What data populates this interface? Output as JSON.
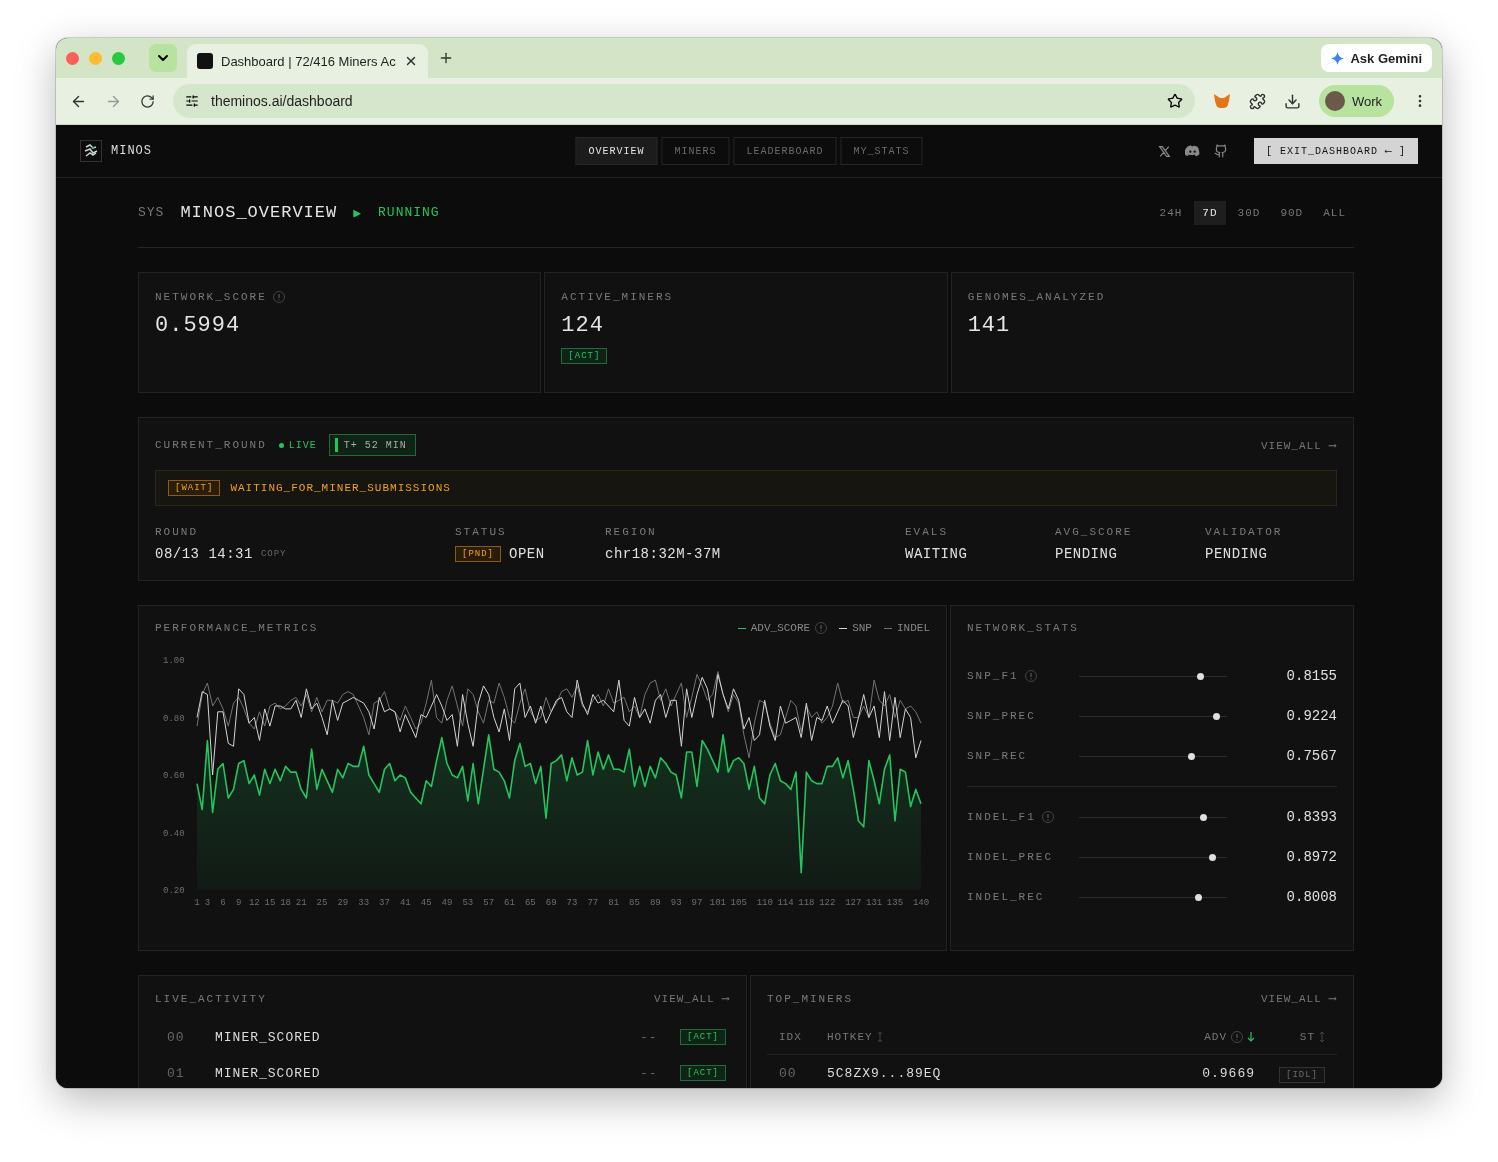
{
  "browser": {
    "tab_title": "Dashboard | 72/416 Miners Ac",
    "url": "theminos.ai/dashboard",
    "gemini_label": "Ask Gemini",
    "profile_label": "Work"
  },
  "header": {
    "brand": "MINOS",
    "nav": [
      {
        "label": "OVERVIEW",
        "selected": true
      },
      {
        "label": "MINERS",
        "selected": false
      },
      {
        "label": "LEADERBOARD",
        "selected": false
      },
      {
        "label": "MY_STATS",
        "selected": false
      }
    ],
    "exit_label": "[ EXIT_DASHBOARD ⟵ ]"
  },
  "title_bar": {
    "prefix": "SYS",
    "title": "MINOS_OVERVIEW",
    "status_icon": "▶",
    "status": "RUNNING",
    "ranges": [
      {
        "label": "24H",
        "selected": false
      },
      {
        "label": "7D",
        "selected": true
      },
      {
        "label": "30D",
        "selected": false
      },
      {
        "label": "90D",
        "selected": false
      },
      {
        "label": "ALL",
        "selected": false
      }
    ]
  },
  "stats": [
    {
      "label": "NETWORK_SCORE",
      "info": true,
      "value": "0.5994"
    },
    {
      "label": "ACTIVE_MINERS",
      "info": false,
      "value": "124",
      "badge": "[ACT]"
    },
    {
      "label": "GENOMES_ANALYZED",
      "info": false,
      "value": "141"
    }
  ],
  "current_round": {
    "title": "CURRENT_ROUND",
    "live": "LIVE",
    "timer": "T+ 52 MIN",
    "view_all": "VIEW_ALL ⟶",
    "alert_badge": "[WAIT]",
    "alert": "WAITING_FOR_MINER_SUBMISSIONS",
    "fields": [
      {
        "label": "ROUND",
        "value": "08/13 14:31",
        "extra": "COPY"
      },
      {
        "label": "STATUS",
        "badge": "[PND]",
        "value": "OPEN"
      },
      {
        "label": "REGION",
        "value": "chr18:32M-37M"
      },
      {
        "label": "EVALS",
        "value": "WAITING"
      },
      {
        "label": "AVG_SCORE",
        "value": "PENDING"
      },
      {
        "label": "VALIDATOR",
        "value": "PENDING"
      }
    ]
  },
  "performance": {
    "title": "PERFORMANCE_METRICS",
    "score_info": true,
    "chart_data": {
      "type": "line",
      "x": [
        1,
        2,
        3,
        4,
        5,
        6,
        7,
        8,
        9,
        10,
        11,
        12,
        13,
        14,
        15,
        16,
        17,
        18,
        19,
        20,
        21,
        22,
        23,
        24,
        25,
        26,
        27,
        28,
        29,
        30,
        31,
        32,
        33,
        34,
        35,
        36,
        37,
        38,
        39,
        40,
        41,
        42,
        43,
        44,
        45,
        46,
        47,
        48,
        49,
        50,
        51,
        52,
        53,
        54,
        55,
        56,
        57,
        58,
        59,
        60,
        61,
        62,
        63,
        64,
        65,
        66,
        67,
        68,
        69,
        70,
        71,
        72,
        73,
        74,
        75,
        76,
        77,
        78,
        79,
        80,
        81,
        82,
        83,
        84,
        85,
        86,
        87,
        88,
        89,
        90,
        91,
        92,
        93,
        94,
        95,
        96,
        97,
        98,
        99,
        100,
        101,
        102,
        103,
        104,
        105,
        106,
        107,
        108,
        109,
        110,
        111,
        112,
        113,
        114,
        115,
        116,
        117,
        118,
        119,
        120,
        121,
        122,
        123,
        124,
        125,
        126,
        127,
        128,
        129,
        130,
        131,
        132,
        133,
        134,
        135,
        136,
        137,
        138,
        139,
        140
      ],
      "ylim": [
        0.2,
        1.0
      ],
      "yticks": [
        {
          "value": 1.0,
          "label": "1.00"
        },
        {
          "value": 0.8,
          "label": "0.80"
        },
        {
          "value": 0.6,
          "label": "0.60"
        },
        {
          "value": 0.4,
          "label": "0.40"
        },
        {
          "value": 0.2,
          "label": "0.20"
        }
      ],
      "xlim": [
        1,
        140
      ],
      "xticks": [
        1,
        3,
        6,
        9,
        12,
        15,
        18,
        21,
        25,
        29,
        33,
        37,
        41,
        45,
        49,
        53,
        57,
        61,
        65,
        69,
        73,
        77,
        81,
        85,
        89,
        93,
        97,
        101,
        105,
        110,
        114,
        118,
        122,
        127,
        131,
        135,
        140
      ],
      "series": [
        {
          "name": "ADV_SCORE",
          "color": "#22c55e",
          "type": "area",
          "values": [
            0.57,
            0.48,
            0.72,
            0.47,
            0.62,
            0.64,
            0.52,
            0.55,
            0.64,
            0.65,
            0.57,
            0.6,
            0.53,
            0.62,
            0.57,
            0.62,
            0.58,
            0.63,
            0.61,
            0.61,
            0.55,
            0.52,
            0.69,
            0.55,
            0.62,
            0.58,
            0.54,
            0.62,
            0.59,
            0.64,
            0.63,
            0.63,
            0.7,
            0.6,
            0.57,
            0.54,
            0.62,
            0.64,
            0.58,
            0.6,
            0.59,
            0.54,
            0.52,
            0.5,
            0.58,
            0.56,
            0.65,
            0.73,
            0.64,
            0.6,
            0.59,
            0.63,
            0.51,
            0.64,
            0.5,
            0.62,
            0.74,
            0.62,
            0.61,
            0.58,
            0.52,
            0.65,
            0.71,
            0.63,
            0.64,
            0.57,
            0.63,
            0.45,
            0.64,
            0.65,
            0.67,
            0.58,
            0.66,
            0.6,
            0.61,
            0.72,
            0.6,
            0.68,
            0.62,
            0.67,
            0.62,
            0.62,
            0.61,
            0.69,
            0.56,
            0.63,
            0.56,
            0.63,
            0.59,
            0.66,
            0.64,
            0.61,
            0.6,
            0.52,
            0.68,
            0.68,
            0.56,
            0.72,
            0.69,
            0.65,
            0.61,
            0.74,
            0.61,
            0.65,
            0.66,
            0.64,
            0.55,
            0.63,
            0.52,
            0.5,
            0.6,
            0.64,
            0.58,
            0.57,
            0.55,
            0.61,
            0.26,
            0.61,
            0.58,
            0.57,
            0.57,
            0.63,
            0.63,
            0.66,
            0.59,
            0.65,
            0.55,
            0.44,
            0.42,
            0.65,
            0.58,
            0.5,
            0.62,
            0.67,
            0.44,
            0.62,
            0.61,
            0.49,
            0.55,
            0.5
          ]
        },
        {
          "name": "SNP",
          "color": "#d4d4d4",
          "values": [
            0.8,
            0.89,
            0.88,
            0.6,
            0.82,
            0.82,
            0.71,
            0.7,
            0.9,
            0.88,
            0.78,
            0.8,
            0.72,
            0.83,
            0.77,
            0.84,
            0.84,
            0.83,
            0.83,
            0.86,
            0.8,
            0.9,
            0.83,
            0.85,
            0.8,
            0.74,
            0.86,
            0.79,
            0.85,
            0.86,
            0.87,
            0.86,
            0.85,
            0.82,
            0.76,
            0.87,
            0.82,
            0.83,
            0.82,
            0.75,
            0.81,
            0.77,
            0.73,
            0.81,
            0.8,
            0.84,
            0.88,
            0.84,
            0.79,
            0.81,
            0.7,
            0.88,
            0.78,
            0.7,
            0.85,
            0.91,
            0.88,
            0.8,
            0.75,
            0.83,
            0.72,
            0.9,
            0.92,
            0.8,
            0.84,
            0.78,
            0.84,
            0.78,
            0.82,
            0.86,
            0.87,
            0.82,
            0.8,
            0.93,
            0.85,
            0.81,
            0.88,
            0.85,
            0.86,
            0.84,
            0.82,
            0.93,
            0.79,
            0.77,
            0.87,
            0.8,
            0.83,
            0.78,
            0.86,
            0.88,
            0.8,
            0.86,
            0.86,
            0.7,
            0.9,
            0.8,
            0.88,
            0.94,
            0.9,
            0.8,
            0.95,
            0.88,
            0.83,
            0.9,
            0.86,
            0.76,
            0.8,
            0.72,
            0.74,
            0.86,
            0.77,
            0.72,
            0.84,
            0.78,
            0.79,
            0.8,
            0.73,
            0.85,
            0.72,
            0.8,
            0.79,
            0.84,
            0.78,
            0.82,
            0.86,
            0.84,
            0.73,
            0.8,
            0.88,
            0.8,
            0.84,
            0.73,
            0.89,
            0.72,
            0.87,
            0.73,
            0.83,
            0.8,
            0.66,
            0.72
          ]
        },
        {
          "name": "INDEL",
          "color": "#737373",
          "values": [
            0.77,
            0.88,
            0.92,
            0.84,
            0.87,
            0.83,
            0.77,
            0.85,
            0.87,
            0.83,
            0.78,
            0.76,
            0.82,
            0.77,
            0.84,
            0.85,
            0.83,
            0.84,
            0.86,
            0.87,
            0.84,
            0.88,
            0.82,
            0.87,
            0.82,
            0.86,
            0.86,
            0.85,
            0.88,
            0.89,
            0.88,
            0.84,
            0.8,
            0.74,
            0.85,
            0.86,
            0.89,
            0.83,
            0.82,
            0.79,
            0.84,
            0.8,
            0.76,
            0.78,
            0.85,
            0.93,
            0.8,
            0.78,
            0.86,
            0.91,
            0.84,
            0.77,
            0.9,
            0.88,
            0.82,
            0.78,
            0.86,
            0.85,
            0.92,
            0.87,
            0.8,
            0.78,
            0.85,
            0.9,
            0.82,
            0.79,
            0.8,
            0.87,
            0.82,
            0.85,
            0.89,
            0.9,
            0.87,
            0.91,
            0.84,
            0.82,
            0.86,
            0.88,
            0.84,
            0.9,
            0.85,
            0.86,
            0.87,
            0.82,
            0.84,
            0.8,
            0.88,
            0.92,
            0.93,
            0.86,
            0.9,
            0.84,
            0.88,
            0.92,
            0.8,
            0.87,
            0.95,
            0.91,
            0.86,
            0.88,
            0.96,
            0.88,
            0.82,
            0.88,
            0.85,
            0.74,
            0.66,
            0.78,
            0.86,
            0.85,
            0.78,
            0.73,
            0.74,
            0.8,
            0.86,
            0.84,
            0.75,
            0.84,
            0.8,
            0.82,
            0.78,
            0.8,
            0.84,
            0.92,
            0.85,
            0.86,
            0.8,
            0.8,
            0.84,
            0.8,
            0.93,
            0.86,
            0.84,
            0.88,
            0.8,
            0.86,
            0.83,
            0.84,
            0.82,
            0.78
          ]
        }
      ]
    }
  },
  "network_stats": {
    "title": "NETWORK_STATS",
    "groups": [
      [
        {
          "label": "SNP_F1",
          "info": true,
          "level": 0.8155,
          "value": "0.8155"
        },
        {
          "label": "SNP_PREC",
          "info": false,
          "level": 0.9224,
          "value": "0.9224"
        },
        {
          "label": "SNP_REC",
          "info": false,
          "level": 0.7567,
          "value": "0.7567"
        }
      ],
      [
        {
          "label": "INDEL_F1",
          "info": true,
          "level": 0.8393,
          "value": "0.8393"
        },
        {
          "label": "INDEL_PREC",
          "info": false,
          "level": 0.8972,
          "value": "0.8972"
        },
        {
          "label": "INDEL_REC",
          "info": false,
          "level": 0.8008,
          "value": "0.8008"
        }
      ]
    ]
  },
  "live_activity": {
    "title": "LIVE_ACTIVITY",
    "view_all": "VIEW_ALL ⟶",
    "rows": [
      {
        "index": "00",
        "event": "MINER_SCORED",
        "detail": "--",
        "badge": "[ACT]",
        "kind": "active"
      },
      {
        "index": "01",
        "event": "MINER_SCORED",
        "detail": "--",
        "badge": "[ACT]",
        "kind": "active"
      }
    ]
  },
  "top_miners": {
    "title": "TOP_MINERS",
    "view_all": "VIEW_ALL ⟶",
    "columns": [
      {
        "label": "IDX",
        "sortable": false,
        "sorted": false,
        "info": false
      },
      {
        "label": "HOTKEY",
        "sortable": true,
        "sorted": false,
        "info": false
      },
      {
        "label": "ADV",
        "sortable": false,
        "sorted": true,
        "info": true
      },
      {
        "label": "ST",
        "sortable": true,
        "sorted": false,
        "info": false
      }
    ],
    "rows": [
      {
        "index": "00",
        "hotkey": "5C8ZX9...89EQ",
        "adv": "0.9669",
        "badge": "[IDL]",
        "kind": "idle"
      }
    ]
  }
}
